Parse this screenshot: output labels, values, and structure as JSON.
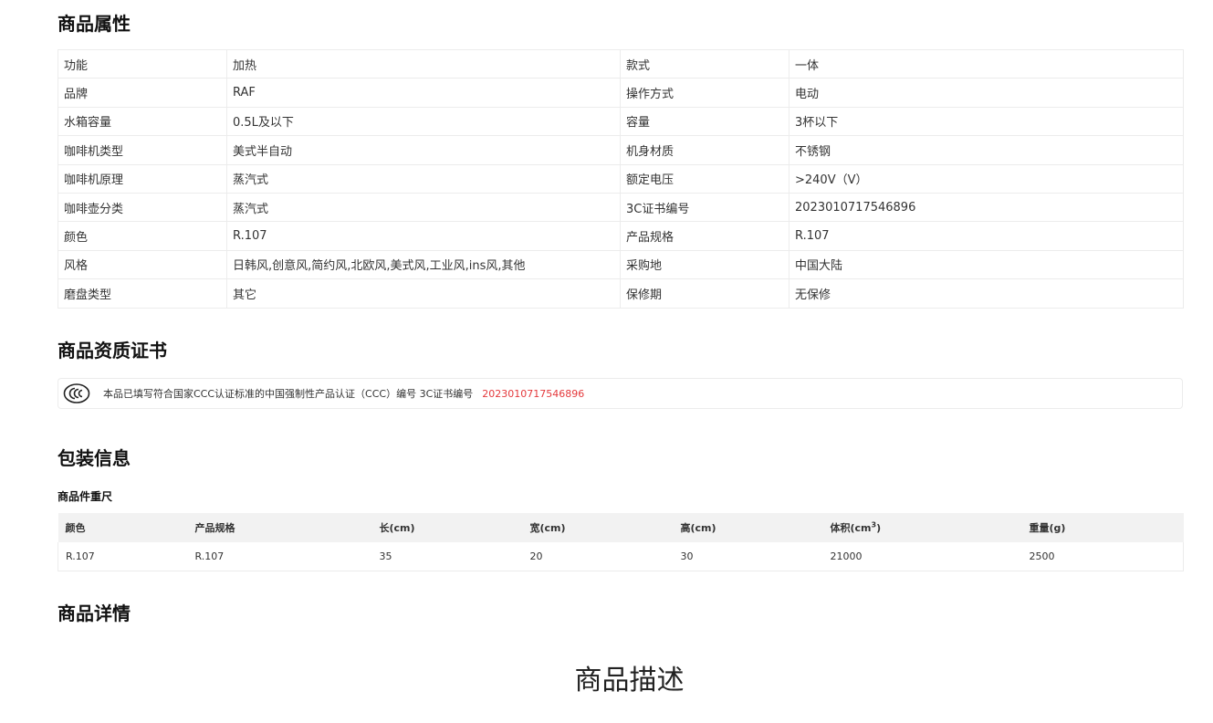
{
  "sections": {
    "attributes_title": "商品属性",
    "certificate_title": "商品资质证书",
    "packaging_title": "包装信息",
    "details_title": "商品详情"
  },
  "attributes": [
    {
      "k1": "功能",
      "v1": "加热",
      "k2": "款式",
      "v2": "一体"
    },
    {
      "k1": "品牌",
      "v1": "RAF",
      "k2": "操作方式",
      "v2": "电动"
    },
    {
      "k1": "水箱容量",
      "v1": "0.5L及以下",
      "k2": "容量",
      "v2": "3杯以下"
    },
    {
      "k1": "咖啡机类型",
      "v1": "美式半自动",
      "k2": "机身材质",
      "v2": "不锈钢"
    },
    {
      "k1": "咖啡机原理",
      "v1": "蒸汽式",
      "k2": "额定电压",
      "v2": ">240V（V）"
    },
    {
      "k1": "咖啡壶分类",
      "v1": "蒸汽式",
      "k2": "3C证书编号",
      "v2": "2023010717546896"
    },
    {
      "k1": "颜色",
      "v1": "R.107",
      "k2": "产品规格",
      "v2": "R.107"
    },
    {
      "k1": "风格",
      "v1": "日韩风,创意风,简约风,北欧风,美式风,工业风,ins风,其他",
      "k2": "采购地",
      "v2": "中国大陆"
    },
    {
      "k1": "磨盘类型",
      "v1": "其它",
      "k2": "保修期",
      "v2": "无保修"
    }
  ],
  "certificate": {
    "logo_icon": "ccc-mark-icon",
    "text": "本品已填写符合国家CCC认证标准的中国强制性产品认证（CCC）编号 3C证书编号",
    "number": "2023010717546896",
    "number_color": "#e4393c"
  },
  "packaging": {
    "subtitle": "商品件重尺",
    "headers": [
      "颜色",
      "产品规格",
      "长(cm)",
      "宽(cm)",
      "高(cm)",
      "体积(cm",
      "重量(g)"
    ],
    "volume_unit_sup": "3",
    "volume_suffix": ")",
    "rows": [
      [
        "R.107",
        "R.107",
        "35",
        "20",
        "30",
        "21000",
        "2500"
      ]
    ]
  },
  "details": {
    "heading": "商品描述"
  }
}
